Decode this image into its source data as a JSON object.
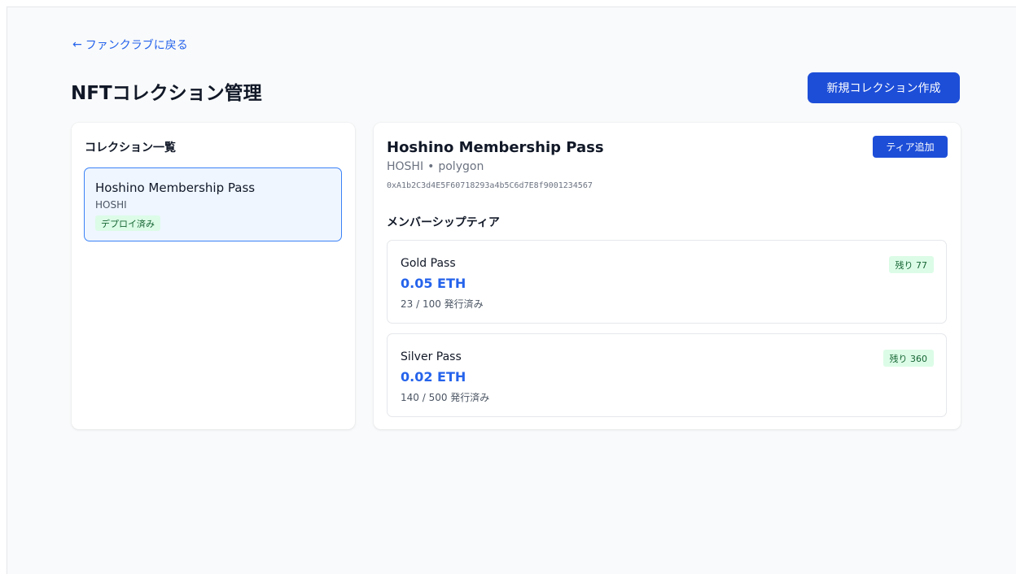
{
  "nav": {
    "back_arrow": "←",
    "back_label": "ファンクラブに戻る"
  },
  "header": {
    "title": "NFTコレクション管理",
    "new_collection_label": "新規コレクション作成"
  },
  "collection_list": {
    "title": "コレクション一覧",
    "items": [
      {
        "name": "Hoshino Membership Pass",
        "symbol": "HOSHI",
        "status": "デプロイ済み"
      }
    ]
  },
  "detail": {
    "name": "Hoshino Membership Pass",
    "symbol": "HOSHI",
    "separator": "•",
    "network": "polygon",
    "address": "0xA1b2C3d4E5F60718293a4b5C6d7E8f9001234567",
    "add_tier_label": "ティア追加",
    "tiers_title": "メンバーシップティア",
    "tiers": [
      {
        "name": "Gold Pass",
        "price": "0.05 ETH",
        "minted": "23 / 100 発行済み",
        "remaining": "残り 77"
      },
      {
        "name": "Silver Pass",
        "price": "0.02 ETH",
        "minted": "140 / 500 発行済み",
        "remaining": "残り 360"
      }
    ]
  },
  "colors": {
    "accent": "#1d4ed8",
    "price": "#2563eb",
    "badge_bg": "#dcfce7",
    "badge_text": "#166534",
    "selected_bg": "#eff6ff",
    "selected_border": "#3b82f6"
  }
}
